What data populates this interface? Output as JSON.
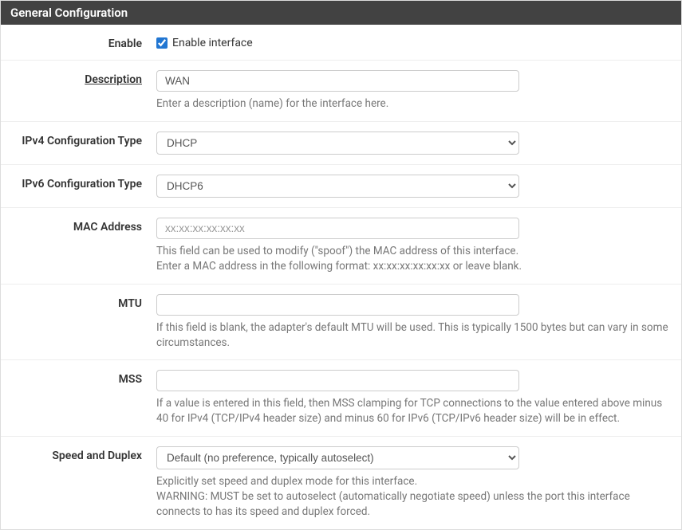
{
  "panel": {
    "title": "General Configuration"
  },
  "fields": {
    "enable": {
      "label": "Enable",
      "checkbox_label": "Enable interface",
      "checked": true
    },
    "description": {
      "label": "Description",
      "value": "WAN",
      "help": "Enter a description (name) for the interface here."
    },
    "ipv4": {
      "label": "IPv4 Configuration Type",
      "value": "DHCP"
    },
    "ipv6": {
      "label": "IPv6 Configuration Type",
      "value": "DHCP6"
    },
    "mac": {
      "label": "MAC Address",
      "value": "",
      "placeholder": "xx:xx:xx:xx:xx:xx",
      "help": "This field can be used to modify (\"spoof\") the MAC address of this interface.\nEnter a MAC address in the following format: xx:xx:xx:xx:xx:xx or leave blank."
    },
    "mtu": {
      "label": "MTU",
      "value": "",
      "help": "If this field is blank, the adapter's default MTU will be used. This is typically 1500 bytes but can vary in some circumstances."
    },
    "mss": {
      "label": "MSS",
      "value": "",
      "help": "If a value is entered in this field, then MSS clamping for TCP connections to the value entered above minus 40 for IPv4 (TCP/IPv4 header size) and minus 60 for IPv6 (TCP/IPv6 header size) will be in effect."
    },
    "speed": {
      "label": "Speed and Duplex",
      "value": "Default (no preference, typically autoselect)",
      "help": "Explicitly set speed and duplex mode for this interface.\nWARNING: MUST be set to autoselect (automatically negotiate speed) unless the port this interface connects to has its speed and duplex forced."
    }
  }
}
